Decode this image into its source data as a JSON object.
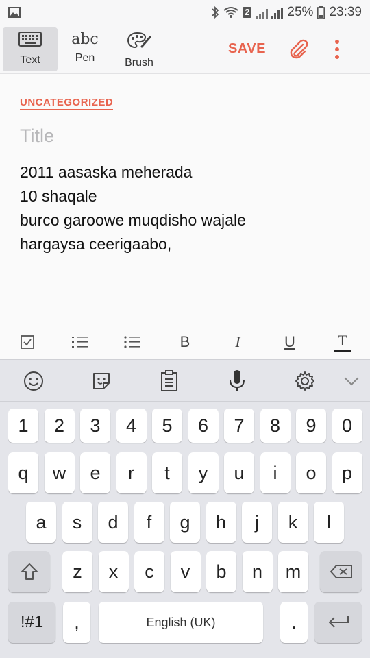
{
  "status": {
    "battery": "25%",
    "time": "23:39",
    "sim": "2"
  },
  "toolbar": {
    "modes": [
      {
        "label": "Text",
        "glyph": "keyboard-icon"
      },
      {
        "label": "Pen",
        "glyph": "abc"
      },
      {
        "label": "Brush",
        "glyph": "palette-icon"
      }
    ],
    "save_label": "SAVE"
  },
  "note": {
    "category": "UNCATEGORIZED",
    "title_placeholder": "Title",
    "lines": [
      "2011 aasaska meherada",
      "10 shaqale",
      "burco garoowe muqdisho wajale",
      "hargaysa ceerigaabo,"
    ]
  },
  "format": {
    "bold": "B",
    "italic": "I",
    "underline": "U",
    "textcolor": "T"
  },
  "keyboard": {
    "row_numbers": [
      "1",
      "2",
      "3",
      "4",
      "5",
      "6",
      "7",
      "8",
      "9",
      "0"
    ],
    "row_top": [
      "q",
      "w",
      "e",
      "r",
      "t",
      "y",
      "u",
      "i",
      "o",
      "p"
    ],
    "row_home": [
      "a",
      "s",
      "d",
      "f",
      "g",
      "h",
      "j",
      "k",
      "l"
    ],
    "row_bottom": [
      "z",
      "x",
      "c",
      "v",
      "b",
      "n",
      "m"
    ],
    "symbols_label": "!#1",
    "comma": ",",
    "space_label": "English (UK)",
    "period": "."
  },
  "colors": {
    "accent": "#e8644f",
    "keyboard_bg": "#e4e5ea"
  }
}
